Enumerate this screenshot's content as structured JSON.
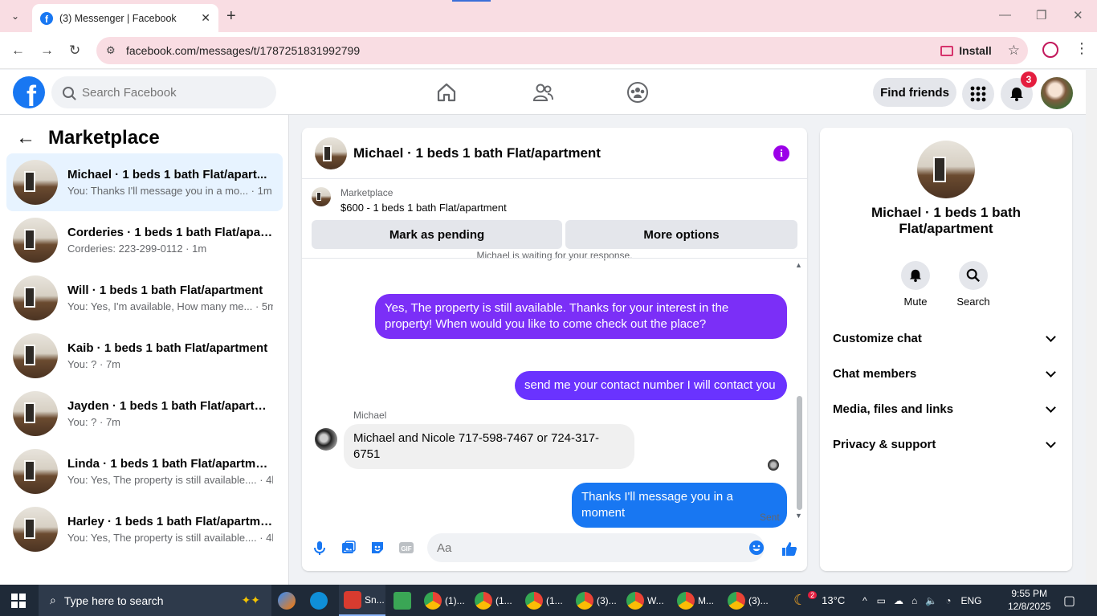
{
  "browser": {
    "tab_title": "(3) Messenger | Facebook",
    "url": "facebook.com/messages/t/1787251831992799",
    "install_label": "Install"
  },
  "fb": {
    "search_placeholder": "Search Facebook",
    "find_friends": "Find friends",
    "notification_count": "3",
    "brand_color": "#1877f2"
  },
  "left": {
    "title": "Marketplace",
    "conversations": [
      {
        "name": "Michael · 1 beds 1 bath Flat/apart...",
        "snippet": "You: Thanks I'll message you in a mo... · 1m"
      },
      {
        "name": "Corderies · 1 beds 1 bath Flat/apart...",
        "snippet": "Corderies: 223-299-0112 · 1m"
      },
      {
        "name": "Will · 1 beds 1 bath Flat/apartment",
        "snippet": "You: Yes, I'm available, How many me... · 5m"
      },
      {
        "name": "Kaib · 1 beds 1 bath Flat/apartment",
        "snippet": "You: ? · 7m"
      },
      {
        "name": "Jayden · 1 beds 1 bath Flat/apartm...",
        "snippet": "You: ? · 7m"
      },
      {
        "name": "Linda · 1 beds 1 bath Flat/apartment",
        "snippet": "You: Yes, The property is still available.... · 4h"
      },
      {
        "name": "Harley · 1 beds 1 bath Flat/apartme...",
        "snippet": "You: Yes, The property is still available.... · 4h"
      }
    ]
  },
  "chat": {
    "title": "Michael · 1 beds 1 bath Flat/apartment",
    "listing_label": "Marketplace",
    "listing_price": "$600 - 1 beds 1 bath Flat/apartment",
    "mark_pending": "Mark as pending",
    "more_options": "More options",
    "waiting_text": "Michael is waiting for your response.",
    "messages": {
      "m1": "Yes, The property is still available. Thanks for your interest in the property! When would you like to come check out the place?",
      "m2": "send me your contact number I will contact you",
      "sender": "Michael",
      "m3": "Michael and Nicole 717-598-7467 or 724-317-6751",
      "m4": "Thanks I'll message you in a moment",
      "status": "Sent"
    },
    "input_placeholder": "Aa"
  },
  "right": {
    "name": "Michael · 1 beds 1 bath Flat/apartment",
    "mute": "Mute",
    "search": "Search",
    "rows": [
      "Customize chat",
      "Chat members",
      "Media, files and links",
      "Privacy & support"
    ]
  },
  "taskbar": {
    "search_placeholder": "Type here to search",
    "apps": [
      "Sn...",
      "(1)...",
      "(1...",
      "(1...",
      "(3)...",
      "W...",
      "M...",
      "(3)..."
    ],
    "weather": "13°C",
    "weather_badge": "2",
    "lang": "ENG",
    "time": "9:55 PM",
    "date": "12/8/2025"
  }
}
